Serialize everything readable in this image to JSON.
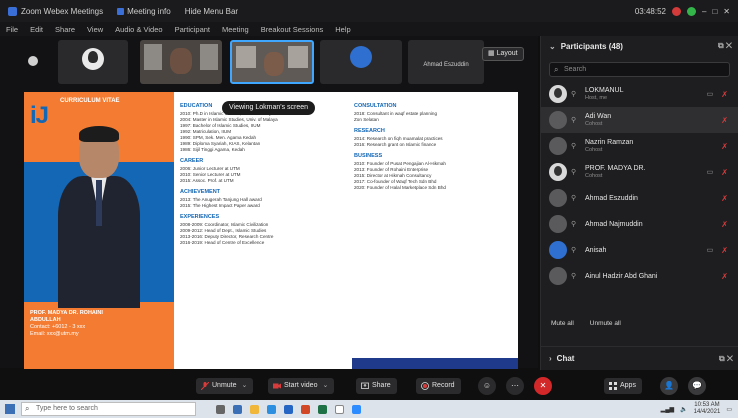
{
  "titlebar": {
    "app_title": "Zoom Webex Meetings",
    "meeting_info": "Meeting info",
    "hide_menu": "Hide Menu Bar",
    "time": "03:48:52",
    "window_controls": [
      "–",
      "□",
      "✕"
    ]
  },
  "menubar": {
    "items": [
      "File",
      "Edit",
      "Share",
      "View",
      "Audio & Video",
      "Participant",
      "Meeting",
      "Breakout Sessions",
      "Help"
    ]
  },
  "thumbnails": [
    {
      "name": "",
      "type": "avatar"
    },
    {
      "name": "",
      "type": "video"
    },
    {
      "name": "",
      "type": "video-active"
    },
    {
      "name": "",
      "type": "avatar-blue"
    },
    {
      "name": "Ahmad Eszuddin",
      "type": "name"
    }
  ],
  "layout_button": {
    "label": "Layout"
  },
  "tooltip": {
    "text": "Viewing Lokman's screen"
  },
  "slide": {
    "logo": "iJ",
    "caption": "CURRICULUM VITAE",
    "prof_lines": [
      "PROF. MADYA DR. ROHAINI",
      "ABDULLAH",
      "",
      "Contact: +6012 - 3 xxx",
      "Email: xxx@utm.my"
    ],
    "col1": [
      {
        "h": "EDUCATION"
      },
      {
        "ln": "2010: Ph.D in Islamic Studies, Univ. of Malaya"
      },
      {
        "ln": "2004: Master in Islamic Studies, Univ. of Malaya"
      },
      {
        "ln": "1997: Bachelor of Islamic Studies, IIUM"
      },
      {
        "ln": "1992: Matriculation, IIUM"
      },
      {
        "ln": "1990: SPM, Sek. Men. Agama Kedah"
      },
      {
        "ln": "1989: Diploma Syariah, KIAS, Kelantan"
      },
      {
        "ln": "1986: Sijil Tinggi Agama, Kedah"
      },
      {
        "h": "CAREER"
      },
      {
        "ln": "2006: Junior Lecturer at UTM"
      },
      {
        "ln": "2010: Senior Lecturer at UTM"
      },
      {
        "ln": "2015: Assoc. Prof. at UTM"
      },
      {
        "h": "ACHIEVEMENT"
      },
      {
        "ln": "2013: The Anugerah Tanjung Hall award"
      },
      {
        "ln": "2015: The Highest Impact Paper award"
      },
      {
        "h": "EXPERIENCES"
      },
      {
        "ln": "2008-2009: Coordinator, Islamic Civilization"
      },
      {
        "ln": "2009-2012: Head of Dept., Islamic Studies"
      },
      {
        "ln": "2013-2016: Deputy Director, Research Centre"
      },
      {
        "ln": "2016-2019: Head of Centre of Excellence"
      }
    ],
    "col2": [
      {
        "h": "CONSULTATION"
      },
      {
        "ln": "2018: Consultant in waqf estate planning"
      },
      {
        "ln": "Zon Selatan"
      },
      {
        "h": "RESEARCH"
      },
      {
        "ln": "2014: Research on fiqh muamalat practices"
      },
      {
        "ln": "2016: Research grant on Islamic finance"
      },
      {
        "h": "BUSINESS"
      },
      {
        "ln": "2010: Founder of Pusat Pengajian Al-Hikmah"
      },
      {
        "ln": "2013: Founder of Rohaini Enterprise"
      },
      {
        "ln": "2015: Director at Hikmah Consultancy"
      },
      {
        "ln": "2017: Co-founder of Waqf Tech Sdn Bhd"
      },
      {
        "ln": "2020: Founder of Halal Marketplace Sdn Bhd"
      }
    ]
  },
  "participants_panel": {
    "title": "Participants (48)",
    "search_placeholder": "Search",
    "rows": [
      {
        "name": "LOKMANUL",
        "role": "Host, me",
        "av": "photo",
        "hl": false
      },
      {
        "name": "Adi Wan",
        "role": "Cohost",
        "av": "gray",
        "hl": true
      },
      {
        "name": "Nazrin Ramzan",
        "role": "Cohost",
        "av": "gray",
        "hl": false
      },
      {
        "name": "PROF. MADYA DR.",
        "role": "Cohost",
        "av": "photo",
        "hl": false
      },
      {
        "name": "Ahmad Eszuddin",
        "role": "",
        "av": "gray",
        "hl": false
      },
      {
        "name": "Ahmad Najmuddin",
        "role": "",
        "av": "gray",
        "hl": false
      },
      {
        "name": "Anisah",
        "role": "",
        "av": "blue",
        "hl": false
      },
      {
        "name": "Ainul Hadzir Abd Ghani",
        "role": "",
        "av": "gray",
        "hl": false
      }
    ],
    "mute_all": "Mute all",
    "unmute_all": "Unmute all",
    "chat_title": "Chat"
  },
  "controls": {
    "unmute": "Unmute",
    "start_video": "Start video",
    "share": "Share",
    "record": "Record",
    "apps": "Apps"
  },
  "taskbar": {
    "search_placeholder": "Type here to search",
    "clock": "10:53 AM",
    "date": "14/4/2021"
  }
}
